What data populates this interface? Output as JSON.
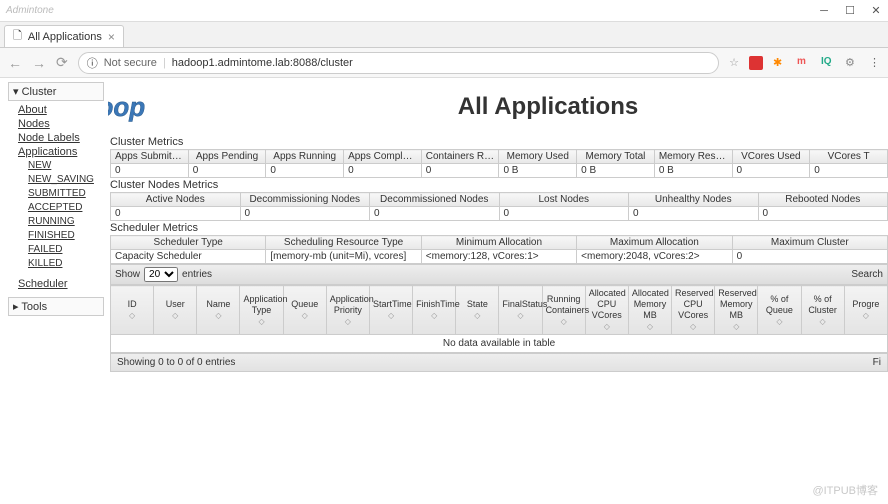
{
  "titlebar": {
    "user": "Admintone"
  },
  "tab": {
    "title": "All Applications"
  },
  "address": {
    "security": "Not secure",
    "url": "hadoop1.admintome.lab:8088/cluster"
  },
  "page": {
    "heading": "All Applications"
  },
  "sidebar": {
    "cluster_label": "Cluster",
    "items": [
      "About",
      "Nodes",
      "Node Labels",
      "Applications"
    ],
    "app_states": [
      "NEW",
      "NEW_SAVING",
      "SUBMITTED",
      "ACCEPTED",
      "RUNNING",
      "FINISHED",
      "FAILED",
      "KILLED"
    ],
    "scheduler": "Scheduler",
    "tools_label": "Tools"
  },
  "cluster_metrics": {
    "title": "Cluster Metrics",
    "headers": [
      "Apps Submitted",
      "Apps Pending",
      "Apps Running",
      "Apps Completed",
      "Containers Running",
      "Memory Used",
      "Memory Total",
      "Memory Reserved",
      "VCores Used",
      "VCores T"
    ],
    "values": [
      "0",
      "0",
      "0",
      "0",
      "0",
      "0 B",
      "0 B",
      "0 B",
      "0",
      "0"
    ]
  },
  "node_metrics": {
    "title": "Cluster Nodes Metrics",
    "headers": [
      "Active Nodes",
      "Decommissioning Nodes",
      "Decommissioned Nodes",
      "Lost Nodes",
      "Unhealthy Nodes",
      "Rebooted Nodes"
    ],
    "values": [
      "0",
      "0",
      "0",
      "0",
      "0",
      "0"
    ]
  },
  "scheduler_metrics": {
    "title": "Scheduler Metrics",
    "headers": [
      "Scheduler Type",
      "Scheduling Resource Type",
      "Minimum Allocation",
      "Maximum Allocation",
      "Maximum Cluster"
    ],
    "values": [
      "Capacity Scheduler",
      "[memory-mb (unit=Mi), vcores]",
      "<memory:128, vCores:1>",
      "<memory:2048, vCores:2>",
      "0"
    ]
  },
  "table": {
    "show_label": "Show",
    "show_value": "20",
    "entries_label": "entries",
    "search_label": "Search",
    "columns": [
      "ID",
      "User",
      "Name",
      "Application Type",
      "Queue",
      "Application Priority",
      "StartTime",
      "FinishTime",
      "State",
      "FinalStatus",
      "Running Containers",
      "Allocated CPU VCores",
      "Allocated Memory MB",
      "Reserved CPU VCores",
      "Reserved Memory MB",
      "% of Queue",
      "% of Cluster",
      "Progre"
    ],
    "no_data": "No data available in table",
    "showing": "Showing 0 to 0 of 0 entries",
    "pagination_right": "Fi"
  },
  "watermark": "@ITPUB博客"
}
